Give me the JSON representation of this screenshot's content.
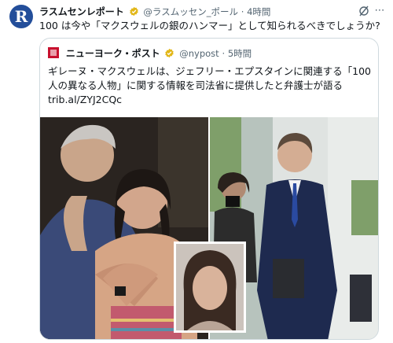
{
  "tweet": {
    "avatar_letter": "R",
    "display_name": "ラスムセンレポート",
    "handle": "@ラスムッセン_ポール",
    "time": "· 4時間",
    "text": "100 は今や「マクスウェルの銀のハンマー」として知られるべきでしょうか?"
  },
  "quote": {
    "display_name": "ニューヨーク・ポスト",
    "handle": "@nypost",
    "time": "· 5時間",
    "text": "ギレーヌ・マクスウェルは、ジェフリー・エプスタインに関連する「100人の異なる人物」に関する情報を司法省に提供したと弁護士が語る",
    "link": "trib.al/ZYJ2CQc"
  },
  "icons": {
    "verified": "verified-badge-icon",
    "grok": "grok-icon",
    "more": "more-icon"
  },
  "colors": {
    "verified_gold": "#e2b719",
    "nypost_red": "#c8102e",
    "avatar_blue": "#234e9a"
  }
}
